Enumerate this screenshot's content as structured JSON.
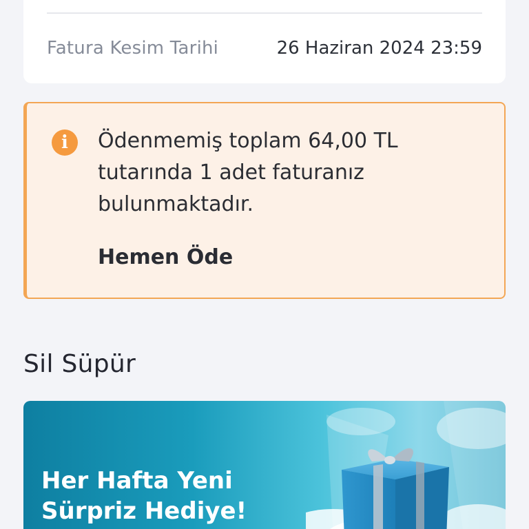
{
  "bill_info": {
    "date_label": "Fatura Kesim Tarihi",
    "date_value": "26 Haziran 2024 23:59"
  },
  "warning": {
    "icon": "info-icon",
    "icon_glyph": "i",
    "message": "Ödenmemiş toplam 64,00 TL tutarında 1 adet faturanız bulunmaktadır.",
    "action_label": "Hemen Öde",
    "accent_color": "#f3a654",
    "background_color": "#fdf1e7"
  },
  "section": {
    "title": "Sil Süpür"
  },
  "promo_banner": {
    "title_line1": "Her Hafta Yeni",
    "title_line2": "Sürpriz Hediye!",
    "image": "gift-box-icon"
  }
}
